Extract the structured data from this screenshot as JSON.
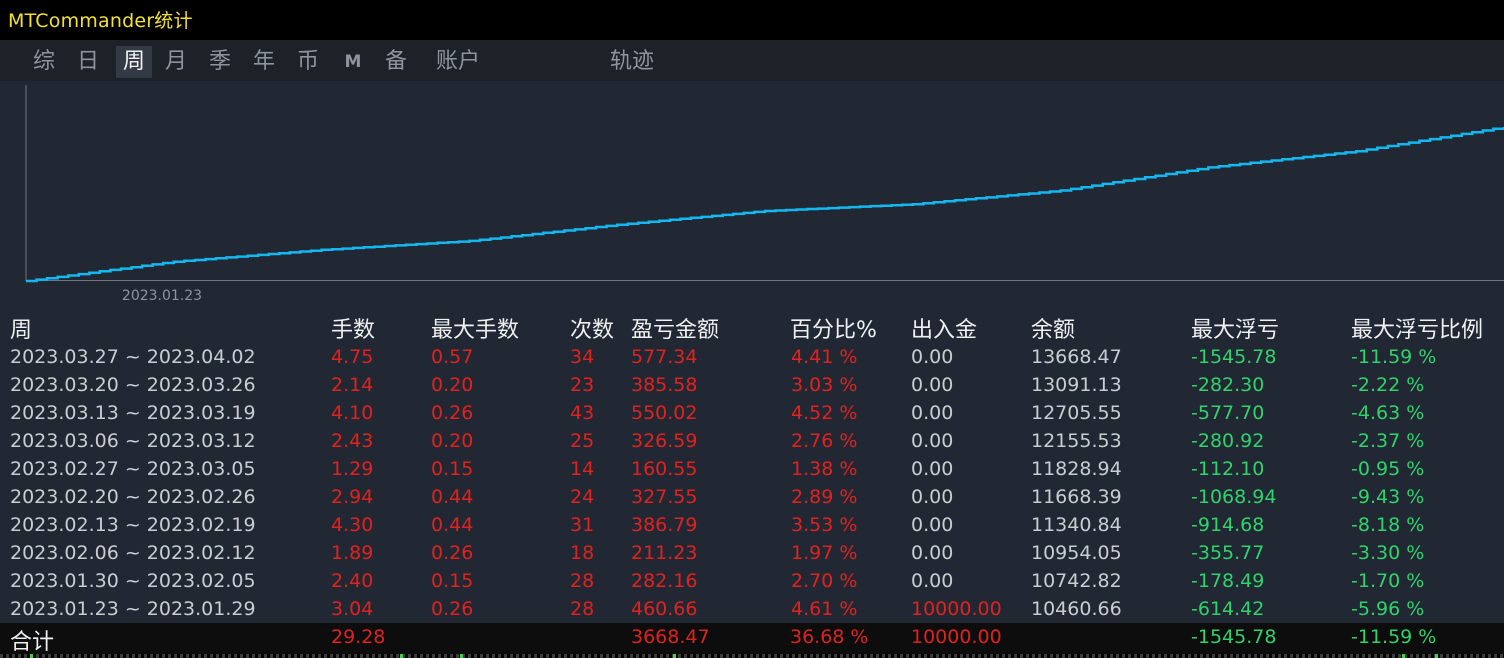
{
  "window": {
    "title": "MTCommander统计"
  },
  "tabs": [
    {
      "label": "综"
    },
    {
      "label": "日"
    },
    {
      "label": "周"
    },
    {
      "label": "月"
    },
    {
      "label": "季"
    },
    {
      "label": "年"
    },
    {
      "label": "币"
    },
    {
      "label": "M"
    },
    {
      "label": "备"
    },
    {
      "label": "账户"
    },
    {
      "label": "轨迹"
    }
  ],
  "active_tab": "周",
  "colors": {
    "line": "#14b8f0",
    "profit": "#e0221f",
    "loss": "#2fd36a",
    "title": "#f4e12e"
  },
  "chart_data": {
    "type": "line",
    "x_tick_labels": [
      "2023.01.23"
    ],
    "series": [
      {
        "values": [
          10000.0,
          10460.66,
          10742.82,
          10954.05,
          11340.84,
          11668.39,
          11828.94,
          12155.53,
          12705.55,
          13091.13,
          13668.47
        ]
      }
    ],
    "grid": false
  },
  "table": {
    "headers": {
      "period": "周",
      "lots": "手数",
      "max_lots": "最大手数",
      "count": "次数",
      "pnl": "盈亏金额",
      "pct": "百分比%",
      "io": "出入金",
      "balance": "余额",
      "max_float": "最大浮亏",
      "max_float_pct": "最大浮亏比例"
    },
    "rows": [
      {
        "period": "2023.03.27 ~ 2023.04.02",
        "lots": "4.75",
        "max_lots": "0.57",
        "count": "34",
        "pnl": "577.34",
        "pct": "4.41 %",
        "io": "0.00",
        "balance": "13668.47",
        "max_float": "-1545.78",
        "max_float_pct": "-11.59 %"
      },
      {
        "period": "2023.03.20 ~ 2023.03.26",
        "lots": "2.14",
        "max_lots": "0.20",
        "count": "23",
        "pnl": "385.58",
        "pct": "3.03 %",
        "io": "0.00",
        "balance": "13091.13",
        "max_float": "-282.30",
        "max_float_pct": "-2.22 %"
      },
      {
        "period": "2023.03.13 ~ 2023.03.19",
        "lots": "4.10",
        "max_lots": "0.26",
        "count": "43",
        "pnl": "550.02",
        "pct": "4.52 %",
        "io": "0.00",
        "balance": "12705.55",
        "max_float": "-577.70",
        "max_float_pct": "-4.63 %"
      },
      {
        "period": "2023.03.06 ~ 2023.03.12",
        "lots": "2.43",
        "max_lots": "0.20",
        "count": "25",
        "pnl": "326.59",
        "pct": "2.76 %",
        "io": "0.00",
        "balance": "12155.53",
        "max_float": "-280.92",
        "max_float_pct": "-2.37 %"
      },
      {
        "period": "2023.02.27 ~ 2023.03.05",
        "lots": "1.29",
        "max_lots": "0.15",
        "count": "14",
        "pnl": "160.55",
        "pct": "1.38 %",
        "io": "0.00",
        "balance": "11828.94",
        "max_float": "-112.10",
        "max_float_pct": "-0.95 %"
      },
      {
        "period": "2023.02.20 ~ 2023.02.26",
        "lots": "2.94",
        "max_lots": "0.44",
        "count": "24",
        "pnl": "327.55",
        "pct": "2.89 %",
        "io": "0.00",
        "balance": "11668.39",
        "max_float": "-1068.94",
        "max_float_pct": "-9.43 %"
      },
      {
        "period": "2023.02.13 ~ 2023.02.19",
        "lots": "4.30",
        "max_lots": "0.44",
        "count": "31",
        "pnl": "386.79",
        "pct": "3.53 %",
        "io": "0.00",
        "balance": "11340.84",
        "max_float": "-914.68",
        "max_float_pct": "-8.18 %"
      },
      {
        "period": "2023.02.06 ~ 2023.02.12",
        "lots": "1.89",
        "max_lots": "0.26",
        "count": "18",
        "pnl": "211.23",
        "pct": "1.97 %",
        "io": "0.00",
        "balance": "10954.05",
        "max_float": "-355.77",
        "max_float_pct": "-3.30 %"
      },
      {
        "period": "2023.01.30 ~ 2023.02.05",
        "lots": "2.40",
        "max_lots": "0.15",
        "count": "28",
        "pnl": "282.16",
        "pct": "2.70 %",
        "io": "0.00",
        "balance": "10742.82",
        "max_float": "-178.49",
        "max_float_pct": "-1.70 %"
      },
      {
        "period": "2023.01.23 ~ 2023.01.29",
        "lots": "3.04",
        "max_lots": "0.26",
        "count": "28",
        "pnl": "460.66",
        "pct": "4.61 %",
        "io": "10000.00",
        "balance": "10460.66",
        "max_float": "-614.42",
        "max_float_pct": "-5.96 %"
      }
    ],
    "footer": {
      "label": "合计",
      "lots": "29.28",
      "pnl": "3668.47",
      "pct": "36.68 %",
      "io": "10000.00",
      "max_float": "-1545.78",
      "max_float_pct": "-11.59 %"
    }
  }
}
